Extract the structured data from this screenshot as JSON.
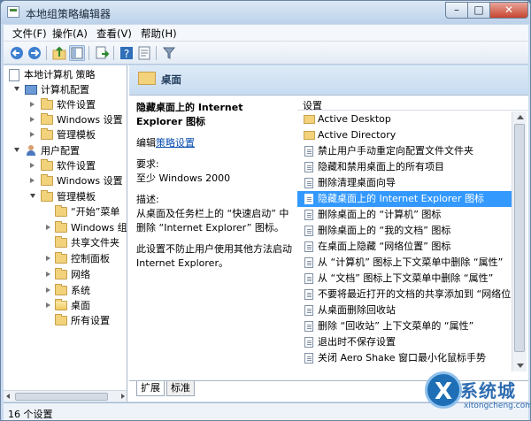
{
  "window": {
    "title": "本地组策略编辑器",
    "controls": {
      "minimize": "–",
      "maximize": "□",
      "close": "✕"
    }
  },
  "menubar": {
    "items": [
      "文件(F)",
      "操作(A)",
      "查看(V)",
      "帮助(H)"
    ]
  },
  "toolbar": {
    "icons": [
      "back-arrow-icon",
      "forward-arrow-icon",
      "up-folder-icon",
      "show-hide-tree-icon",
      "export-list-icon",
      "help-icon",
      "properties-icon",
      "filter-icon"
    ]
  },
  "tree": {
    "items": [
      {
        "label": "本地计算机 策略",
        "icon": "policy-page-icon",
        "expanded": true
      },
      {
        "label": "计算机配置",
        "icon": "computer-icon",
        "expanded": true
      },
      {
        "label": "软件设置",
        "icon": "folder-icon",
        "expanded": false
      },
      {
        "label": "Windows 设置",
        "icon": "folder-icon",
        "expanded": false
      },
      {
        "label": "管理模板",
        "icon": "folder-icon",
        "expanded": false
      },
      {
        "label": "用户配置",
        "icon": "user-icon",
        "expanded": true
      },
      {
        "label": "软件设置",
        "icon": "folder-icon",
        "expanded": false
      },
      {
        "label": "Windows 设置",
        "icon": "folder-icon",
        "expanded": false
      },
      {
        "label": "管理模板",
        "icon": "folder-icon",
        "expanded": true
      },
      {
        "label": "“开始”菜单",
        "icon": "folder-icon",
        "expanded": false
      },
      {
        "label": "Windows 组",
        "icon": "folder-icon",
        "expanded": false
      },
      {
        "label": "共享文件夹",
        "icon": "folder-icon",
        "expanded": false
      },
      {
        "label": "控制面板",
        "icon": "folder-icon",
        "expanded": false
      },
      {
        "label": "网络",
        "icon": "folder-icon",
        "expanded": false
      },
      {
        "label": "系统",
        "icon": "folder-icon",
        "expanded": false
      },
      {
        "label": "桌面",
        "icon": "folder-open-icon",
        "expanded": true
      },
      {
        "label": "所有设置",
        "icon": "folder-icon",
        "expanded": false
      }
    ]
  },
  "header": {
    "title": "桌面"
  },
  "description": {
    "policy_title": "隐藏桌面上的 Internet Explorer 图标",
    "edit_prefix": "编辑",
    "edit_link": "策略设置",
    "requirements_label": "要求:",
    "requirements_value": "至少 Windows 2000",
    "description_label": "描述:",
    "description_text": "从桌面及任务栏上的 “快速启动” 中删除 “Internet Explorer” 图标。",
    "note_text": "此设置不防止用户使用其他方法启动 Internet Explorer。"
  },
  "list": {
    "column_header": "设置",
    "selected_index": 5,
    "rows": [
      {
        "label": "Active Desktop",
        "type": "folder"
      },
      {
        "label": "Active Directory",
        "type": "folder"
      },
      {
        "label": "禁止用户手动重定向配置文件文件夹",
        "type": "setting"
      },
      {
        "label": "隐藏和禁用桌面上的所有项目",
        "type": "setting"
      },
      {
        "label": "删除清理桌面向导",
        "type": "setting"
      },
      {
        "label": "隐藏桌面上的 Internet Explorer 图标",
        "type": "setting"
      },
      {
        "label": "删除桌面上的 “计算机” 图标",
        "type": "setting"
      },
      {
        "label": "删除桌面上的 “我的文档” 图标",
        "type": "setting"
      },
      {
        "label": "在桌面上隐藏 “网络位置” 图标",
        "type": "setting"
      },
      {
        "label": "从 “计算机” 图标上下文菜单中删除 “属性”",
        "type": "setting"
      },
      {
        "label": "从 “文档” 图标上下文菜单中删除 “属性”",
        "type": "setting"
      },
      {
        "label": "不要将最近打开的文档的共享添加到 “网络位置”",
        "type": "setting"
      },
      {
        "label": "从桌面删除回收站",
        "type": "setting"
      },
      {
        "label": "删除 “回收站” 上下文菜单的 “属性”",
        "type": "setting"
      },
      {
        "label": "退出时不保存设置",
        "type": "setting"
      },
      {
        "label": "关闭 Aero Shake 窗口最小化鼠标手势",
        "type": "setting"
      }
    ]
  },
  "tabs": [
    "扩展",
    "标准"
  ],
  "status": {
    "text": "16 个设置"
  },
  "watermark": {
    "mark": "X",
    "name": "系统城",
    "url": "xitongcheng.com"
  }
}
